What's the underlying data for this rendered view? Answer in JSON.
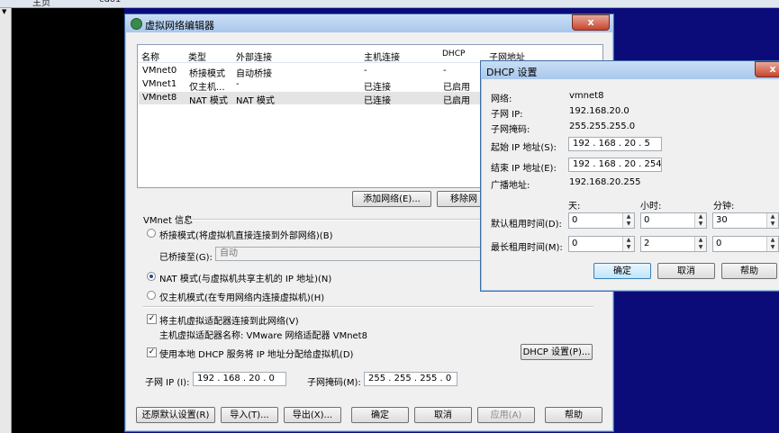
{
  "background": {
    "top_tabs": [
      "主页",
      "cdo1"
    ]
  },
  "main": {
    "title": "虚拟网络编辑器",
    "close_label": "x",
    "columns": [
      "名称",
      "类型",
      "外部连接",
      "主机连接",
      "DHCP",
      "子网地址"
    ],
    "rows": [
      {
        "name": "VMnet0",
        "type": "桥接模式",
        "ext": "自动桥接",
        "host": "-",
        "dhcp": "-"
      },
      {
        "name": "VMnet1",
        "type": "仅主机...",
        "ext": "-",
        "host": "已连接",
        "dhcp": "已启用"
      },
      {
        "name": "VMnet8",
        "type": "NAT 模式",
        "ext": "NAT 模式",
        "host": "已连接",
        "dhcp": "已启用"
      }
    ],
    "add_network": "添加网络(E)...",
    "remove_network": "移除网",
    "vmnet_info": "VMnet 信息",
    "bridge_mode": "桥接模式(将虚拟机直接连接到外部网络)(B)",
    "bridged_to": "已桥接至(G):",
    "bridged_to_value": "自动",
    "nat_mode": "NAT 模式(与虚拟机共享主机的 IP 地址)(N)",
    "host_only": "仅主机模式(在专用网络内连接虚拟机)(H)",
    "connect_adapter": "将主机虚拟适配器连接到此网络(V)",
    "adapter_name": "主机虚拟适配器名称: VMware 网络适配器 VMnet8",
    "use_dhcp": "使用本地 DHCP 服务将 IP 地址分配给虚拟机(D)",
    "dhcp_settings": "DHCP 设置(P)...",
    "subnet_ip_label": "子网 IP (I):",
    "subnet_ip": "192 . 168 . 20 . 0",
    "subnet_mask_label": "子网掩码(M):",
    "subnet_mask": "255 . 255 . 255 . 0",
    "restore": "还原默认设置(R)",
    "import": "导入(T)...",
    "export": "导出(X)...",
    "ok": "确定",
    "cancel": "取消",
    "apply": "应用(A)",
    "help": "帮助"
  },
  "dhcp": {
    "title": "DHCP 设置",
    "close_label": "x",
    "network_label": "网络:",
    "network": "vmnet8",
    "subnet_ip_label": "子网 IP:",
    "subnet_ip": "192.168.20.0",
    "mask_label": "子网掩码:",
    "mask": "255.255.255.0",
    "start_label": "起始 IP 地址(S):",
    "start_ip": "192 . 168 . 20 . 5",
    "end_label": "结束 IP 地址(E):",
    "end_ip": "192 . 168 . 20 . 254",
    "broadcast_label": "广播地址:",
    "broadcast": "192.168.20.255",
    "days": "天:",
    "hours": "小时:",
    "minutes": "分钟:",
    "default_lease_label": "默认租用时间(D):",
    "default_lease": [
      "0",
      "0",
      "30"
    ],
    "max_lease_label": "最长租用时间(M):",
    "max_lease": [
      "0",
      "2",
      "0"
    ],
    "ok": "确定",
    "cancel": "取消",
    "help": "帮助"
  }
}
